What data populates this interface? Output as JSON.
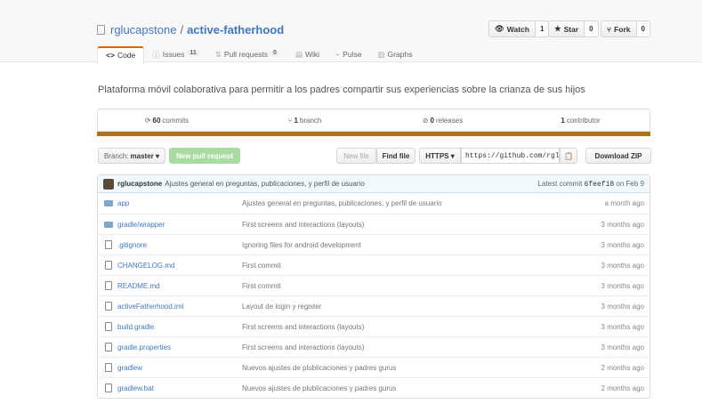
{
  "repo": {
    "owner": "rglucapstone",
    "separator": "/",
    "name": "active-fatherhood"
  },
  "actions": [
    {
      "icon": "👁",
      "label": "Watch",
      "count": "1"
    },
    {
      "icon": "★",
      "label": "Star",
      "count": "0"
    },
    {
      "icon": "⑂",
      "label": "Fork",
      "count": "0"
    }
  ],
  "tabs": [
    {
      "icon": "<>",
      "label": "Code",
      "count": ""
    },
    {
      "icon": "ⓘ",
      "label": "Issues",
      "count": "11"
    },
    {
      "icon": "⇅",
      "label": "Pull requests",
      "count": "0"
    },
    {
      "icon": "▤",
      "label": "Wiki",
      "count": ""
    },
    {
      "icon": "⌁",
      "label": "Pulse",
      "count": ""
    },
    {
      "icon": "▥",
      "label": "Graphs",
      "count": ""
    }
  ],
  "description": "Plataforma móvil colaborativa para permitir a los padres compartir sus experiencias sobre la crianza de sus hijos",
  "summary": {
    "commits": {
      "icon": "⟳",
      "num": "60",
      "label": "commits"
    },
    "branches": {
      "icon": "⑂",
      "num": "1",
      "label": "branch"
    },
    "releases": {
      "icon": "⊘",
      "num": "0",
      "label": "releases"
    },
    "contributors": {
      "num": "1",
      "label": "contributor"
    }
  },
  "filebar": {
    "branch_prefix": "Branch:",
    "branch_name": "master ▾",
    "new_pr": "New pull request",
    "new_file": "New file",
    "find_file": "Find file",
    "protocol": "HTTPS ▾",
    "clone_url": "https://github.com/rglucapstone/active-fatherhood.git",
    "clip_icon": "📋",
    "download": "Download ZIP"
  },
  "commit": {
    "author": "rglucapstone",
    "message": "Ajustes general en preguntas, publicaciones, y perfil de usuario",
    "latest_label": "Latest commit",
    "sha": "6feef18",
    "date": "on Feb 9"
  },
  "files": [
    {
      "type": "dir",
      "name": "app",
      "message": "Ajustes general en preguntas, publicaciones, y perfil de usuario",
      "age": "a month ago"
    },
    {
      "type": "dir",
      "name": "gradle/wrapper",
      "message": "First screens and interactions (layouts)",
      "age": "3 months ago"
    },
    {
      "type": "file",
      "name": ".gitignore",
      "message": "Ignoring files for android development",
      "age": "3 months ago"
    },
    {
      "type": "file",
      "name": "CHANGELOG.md",
      "message": "First commit",
      "age": "3 months ago"
    },
    {
      "type": "file",
      "name": "README.md",
      "message": "First commit",
      "age": "3 months ago"
    },
    {
      "type": "file",
      "name": "activeFatherhood.iml",
      "message": "Layout de login y register",
      "age": "3 months ago"
    },
    {
      "type": "file",
      "name": "build.gradle",
      "message": "First screens and interactions (layouts)",
      "age": "3 months ago"
    },
    {
      "type": "file",
      "name": "gradle.properties",
      "message": "First screens and interactions (layouts)",
      "age": "3 months ago"
    },
    {
      "type": "file",
      "name": "gradlew",
      "message": "Nuevos ajustes de plublicaciones y padres gurus",
      "age": "2 months ago"
    },
    {
      "type": "file",
      "name": "gradlew.bat",
      "message": "Nuevos ajustes de plublicaciones y padres gurus",
      "age": "2 months ago"
    }
  ],
  "colors": {
    "link": "#4078c0",
    "accent_tab": "#d26911",
    "lang_bar": "#b07219",
    "new_pr": "#a8dca1"
  }
}
